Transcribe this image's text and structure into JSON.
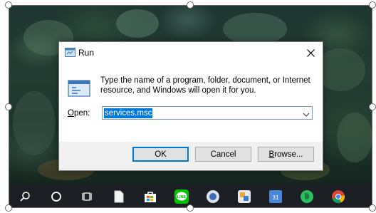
{
  "dialog": {
    "title": "Run",
    "description": "Type the name of a program, folder, document, or Internet resource, and Windows will open it for you.",
    "open_label_accel": "O",
    "open_label_rest": "pen:",
    "input_value": "services.msc",
    "ok_label": "OK",
    "cancel_label": "Cancel",
    "browse_label_accel": "B",
    "browse_label_rest": "rowse..."
  },
  "taskbar": {
    "icons": [
      "search-icon",
      "cortana-icon",
      "task-view-icon",
      "file-icon",
      "store-icon",
      "line-app-icon",
      "app-icon",
      "app-icon-2",
      "calendar-icon",
      "evernote-icon",
      "chrome-icon"
    ],
    "calendar_day": "31",
    "line_text": "LINE"
  },
  "colors": {
    "accent": "#0078d7",
    "taskbar": "#1b1f24",
    "dialog_bg": "#f0f0f0"
  }
}
